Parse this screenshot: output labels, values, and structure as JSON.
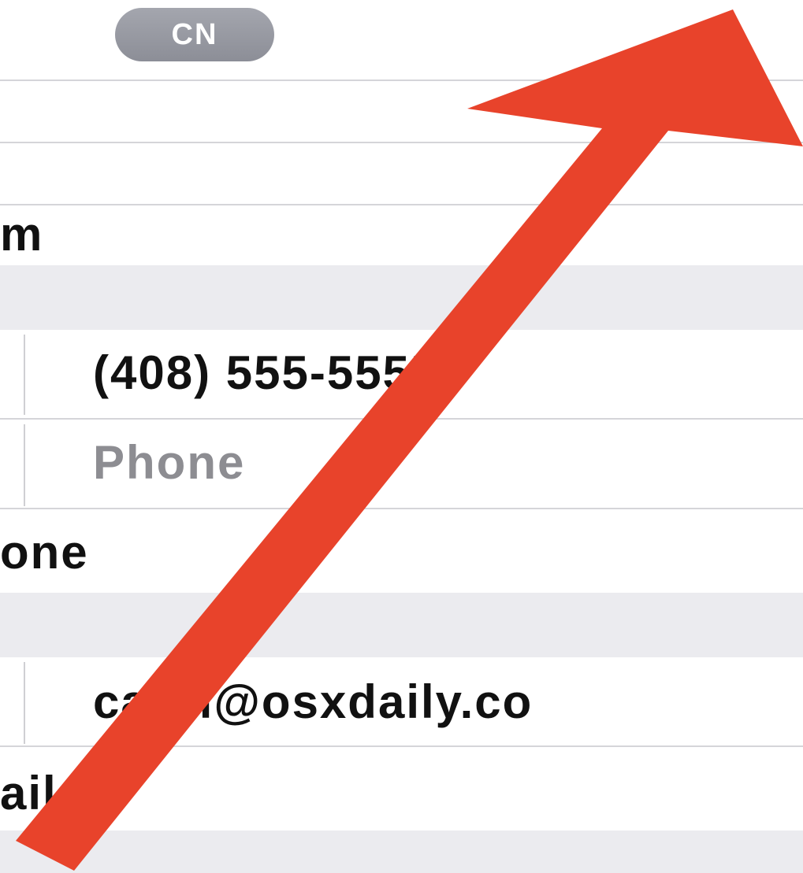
{
  "contact": {
    "avatar_initials": "CN",
    "name_row_text": "m",
    "phone_value": "(408) 555-5555",
    "phone_placeholder": "Phone",
    "add_phone_text": "one",
    "email_value": "carol@osxdaily.co",
    "add_email_text": "ail"
  },
  "colors": {
    "annotation_arrow": "#e8432b",
    "section_gap": "#ebebef",
    "avatar": "#989aa2",
    "placeholder_text": "#8d8d92"
  },
  "annotation": {
    "icon": "arrow-up-right-icon"
  }
}
